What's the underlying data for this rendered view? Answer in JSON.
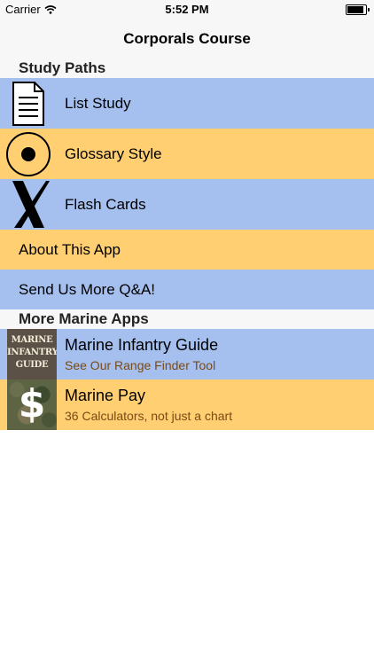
{
  "status_bar": {
    "carrier": "Carrier",
    "time": "5:52 PM",
    "battery_level": 0.9
  },
  "nav": {
    "title": "Corporals Course"
  },
  "sections": {
    "study_paths": "Study Paths",
    "more_apps": "More Marine Apps"
  },
  "study_items": [
    {
      "label": "List Study",
      "icon": "document-icon"
    },
    {
      "label": "Glossary Style",
      "icon": "target-circle-icon"
    },
    {
      "label": "Flash Cards",
      "icon": "x-cross-icon"
    }
  ],
  "info_items": [
    {
      "label": "About This App"
    },
    {
      "label": "Send Us More Q&A!"
    }
  ],
  "apps": [
    {
      "title": "Marine Infantry Guide",
      "subtitle": "See Our Range Finder Tool",
      "thumb_text": [
        "MARINE",
        "INFANTRY",
        "GUIDE"
      ]
    },
    {
      "title": "Marine Pay",
      "subtitle": "36 Calculators, not just a chart",
      "thumb_text": "$"
    }
  ],
  "colors": {
    "blue": "#a5bfee",
    "orange": "#ffcf72",
    "subtitle": "#7a4a15"
  }
}
